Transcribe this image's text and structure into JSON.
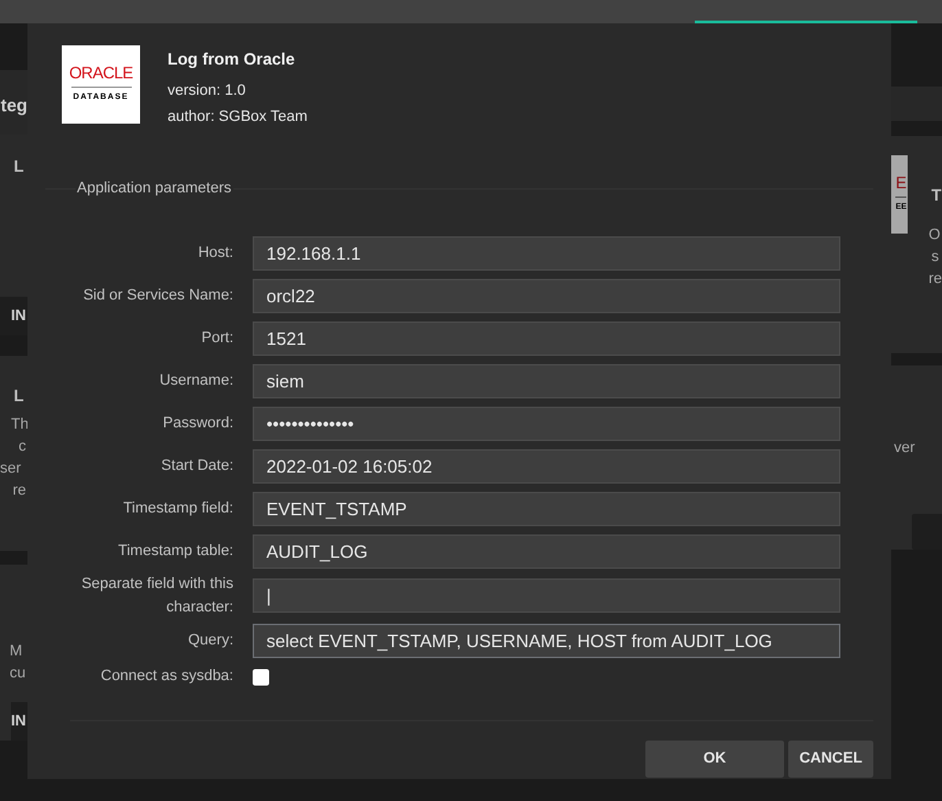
{
  "background": {
    "left_fragments": [
      {
        "kind": "heading",
        "text": "teg"
      },
      {
        "kind": "title",
        "text": "L"
      },
      {
        "kind": "button",
        "text": "IN"
      },
      {
        "kind": "title",
        "text": "L"
      },
      {
        "kind": "line",
        "text": "Th"
      },
      {
        "kind": "line",
        "text": "c"
      },
      {
        "kind": "line",
        "text": "ser"
      },
      {
        "kind": "line",
        "text": "re"
      },
      {
        "kind": "line",
        "text": "M"
      },
      {
        "kind": "line",
        "text": "cu"
      },
      {
        "kind": "button",
        "text": "IN"
      }
    ],
    "right_logo": {
      "brand": "E",
      "product": "EE"
    },
    "right_fragments": [
      {
        "kind": "title",
        "text": "T"
      },
      {
        "kind": "line",
        "text": "O"
      },
      {
        "kind": "line",
        "text": "s"
      },
      {
        "kind": "line",
        "text": "re"
      },
      {
        "kind": "line",
        "text": "ver"
      }
    ]
  },
  "dialog": {
    "logo": {
      "brand": "ORACLE",
      "product": "DATABASE"
    },
    "title": "Log from Oracle",
    "version": "version: 1.0",
    "author": "author: SGBox Team",
    "section": "Application parameters",
    "fields": [
      {
        "kind": "text",
        "label": "Host:",
        "value": "192.168.1.1",
        "focused": false
      },
      {
        "kind": "text",
        "label": "Sid or Services Name:",
        "value": "orcl22",
        "focused": false
      },
      {
        "kind": "text",
        "label": "Port:",
        "value": "1521",
        "focused": false
      },
      {
        "kind": "text",
        "label": "Username:",
        "value": "siem",
        "focused": false
      },
      {
        "kind": "text",
        "label": "Password:",
        "value": "••••••••••••••",
        "focused": false
      },
      {
        "kind": "text",
        "label": "Start Date:",
        "value": "2022-01-02 16:05:02",
        "focused": false
      },
      {
        "kind": "text",
        "label": "Timestamp field:",
        "value": "EVENT_TSTAMP",
        "focused": false
      },
      {
        "kind": "text",
        "label": "Timestamp table:",
        "value": "AUDIT_LOG",
        "focused": false
      },
      {
        "kind": "text",
        "label": "Separate field with this character:",
        "value": "|",
        "focused": false
      },
      {
        "kind": "text",
        "label": "Query:",
        "value": "select EVENT_TSTAMP, USERNAME, HOST from AUDIT_LOG",
        "focused": true
      },
      {
        "kind": "checkbox",
        "label": "Connect as sysdba:",
        "checked": false
      }
    ],
    "buttons": [
      "OK",
      "CANCEL"
    ]
  }
}
